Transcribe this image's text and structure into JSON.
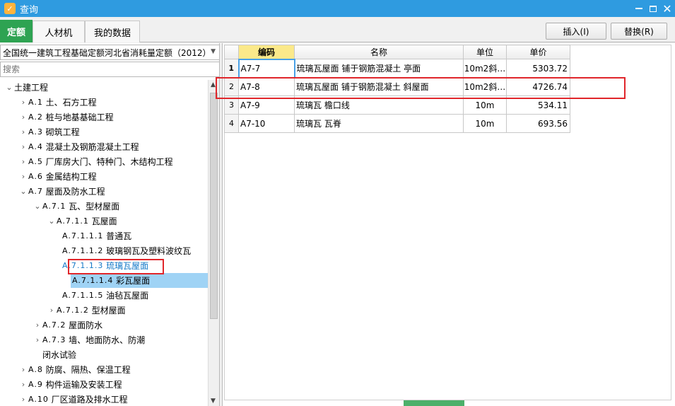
{
  "window": {
    "title": "查询",
    "app_icon": "app-logo-icon",
    "accent": "#2f9be0"
  },
  "tabs": [
    {
      "label": "定额",
      "active": true
    },
    {
      "label": "人材机",
      "active": false
    },
    {
      "label": "我的数据",
      "active": false
    }
  ],
  "actions": {
    "insert_label": "插入(I)",
    "replace_label": "替换(R)"
  },
  "quota_library": {
    "selected": "全国统一建筑工程基础定额河北省消耗量定额（2012）"
  },
  "search": {
    "placeholder": "搜索",
    "value": ""
  },
  "tree": [
    {
      "label": "土建工程",
      "code": "",
      "level": 0,
      "expander": "collapse"
    },
    {
      "code": "A.1",
      "label": "土、石方工程",
      "level": 1,
      "expander": "expand"
    },
    {
      "code": "A.2",
      "label": "桩与地基基础工程",
      "level": 1,
      "expander": "expand"
    },
    {
      "code": "A.3",
      "label": "砌筑工程",
      "level": 1,
      "expander": "expand"
    },
    {
      "code": "A.4",
      "label": "混凝土及钢筋混凝土工程",
      "level": 1,
      "expander": "expand"
    },
    {
      "code": "A.5",
      "label": "厂库房大门、特种门、木结构工程",
      "level": 1,
      "expander": "expand"
    },
    {
      "code": "A.6",
      "label": "金属结构工程",
      "level": 1,
      "expander": "expand"
    },
    {
      "code": "A.7",
      "label": "屋面及防水工程",
      "level": 1,
      "expander": "collapse"
    },
    {
      "code": "A.7.1",
      "label": "瓦、型材屋面",
      "level": 2,
      "expander": "collapse"
    },
    {
      "code": "A.7.1.1",
      "label": "瓦屋面",
      "level": 3,
      "expander": "collapse"
    },
    {
      "code": "A.7.1.1.1",
      "label": "普通瓦",
      "level": 4,
      "expander": ""
    },
    {
      "code": "A.7.1.1.2",
      "label": "玻璃钢瓦及塑料波纹瓦",
      "level": 4,
      "expander": ""
    },
    {
      "code": "A.7.1.1.3",
      "label": "琉璃瓦屋面",
      "level": 4,
      "expander": "",
      "state": "highlighted"
    },
    {
      "code": "A.7.1.1.4",
      "label": "彩瓦屋面",
      "level": 4,
      "expander": "",
      "state": "selected"
    },
    {
      "code": "A.7.1.1.5",
      "label": "油毡瓦屋面",
      "level": 4,
      "expander": ""
    },
    {
      "code": "A.7.1.2",
      "label": "型材屋面",
      "level": 3,
      "expander": "expand"
    },
    {
      "code": "A.7.2",
      "label": "屋面防水",
      "level": 2,
      "expander": "expand"
    },
    {
      "code": "A.7.3",
      "label": "墙、地面防水、防潮",
      "level": 2,
      "expander": "expand"
    },
    {
      "code": "",
      "label": "闭水试验",
      "level": 2,
      "expander": ""
    },
    {
      "code": "A.8",
      "label": "防腐、隔热、保温工程",
      "level": 1,
      "expander": "expand"
    },
    {
      "code": "A.9",
      "label": "构件运输及安装工程",
      "level": 1,
      "expander": "expand"
    },
    {
      "code": "A.10",
      "label": "厂区道路及排水工程",
      "level": 1,
      "expander": "expand"
    }
  ],
  "grid": {
    "headers": {
      "code": "编码",
      "name": "名称",
      "unit": "单位",
      "price": "单价"
    },
    "rows": [
      {
        "idx": "1",
        "code": "A7-7",
        "name": "琉璃瓦屋面 铺于钢筋混凝土 亭面",
        "unit": "10m2斜…",
        "price": "5303.72",
        "current": true
      },
      {
        "idx": "2",
        "code": "A7-8",
        "name": "琉璃瓦屋面 铺于钢筋混凝土 斜屋面",
        "unit": "10m2斜…",
        "price": "4726.74",
        "current": false
      },
      {
        "idx": "3",
        "code": "A7-9",
        "name": "琉璃瓦 檐口线",
        "unit": "10m",
        "price": "534.11",
        "current": false
      },
      {
        "idx": "4",
        "code": "A7-10",
        "name": "琉璃瓦 瓦脊",
        "unit": "10m",
        "price": "693.56",
        "current": false
      }
    ]
  },
  "colors": {
    "active_tab": "#2ea352",
    "highlight_box": "#e0262b",
    "selected_row": "#9fd3f5",
    "key_header": "#fbe98a"
  }
}
